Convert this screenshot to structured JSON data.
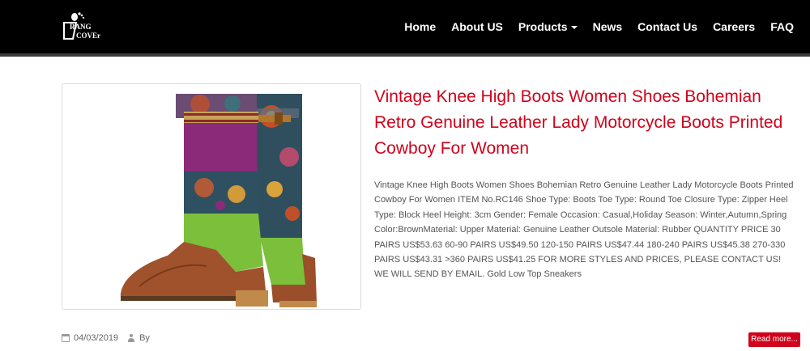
{
  "header": {
    "logo_text_top": "RANG",
    "logo_text_bottom": "COVEr",
    "nav": [
      {
        "label": "Home"
      },
      {
        "label": "About US"
      },
      {
        "label": "Products"
      },
      {
        "label": "News"
      },
      {
        "label": "Contact Us"
      },
      {
        "label": "Careers"
      },
      {
        "label": "FAQ"
      }
    ]
  },
  "product": {
    "title": "Vintage Knee High Boots Women Shoes Bohemian Retro Genuine Leather Lady Motorcycle Boots Printed Cowboy For Women",
    "description": "Vintage Knee High Boots Women Shoes Bohemian Retro Genuine Leather Lady Motorcycle Boots Printed Cowboy For Women ITEM No.RC146 Shoe Type: Boots Toe Type: Round Toe Closure Type: Zipper Heel Type: Block Heel Height: 3cm Gender: Female Occasion: Casual,Holiday Season: Winter,Autumn,Spring Color:BrownMaterial: Upper Material: Genuine Leather Outsole Material: Rubber QUANTITY PRICE 30 PAIRS US$53.63 60-90 PAIRS US$49.50 120-150 PAIRS US$47.44 180-240 PAIRS US$45.38 270-330 PAIRS US$43.31 >360 PAIRS US$41.25 FOR MORE STYLES AND PRICES, PLEASE CONTACT US! WE WILL SEND BY EMAIL. Gold Low Top Sneakers",
    "date": "04/03/2019",
    "author_label": "By",
    "read_more_label": "Read more..."
  },
  "colors": {
    "accent": "#d0021b",
    "header_bg": "#000000"
  },
  "icons": [
    "footprint-logo-icon",
    "calendar-icon",
    "user-icon",
    "caret-down-icon"
  ]
}
